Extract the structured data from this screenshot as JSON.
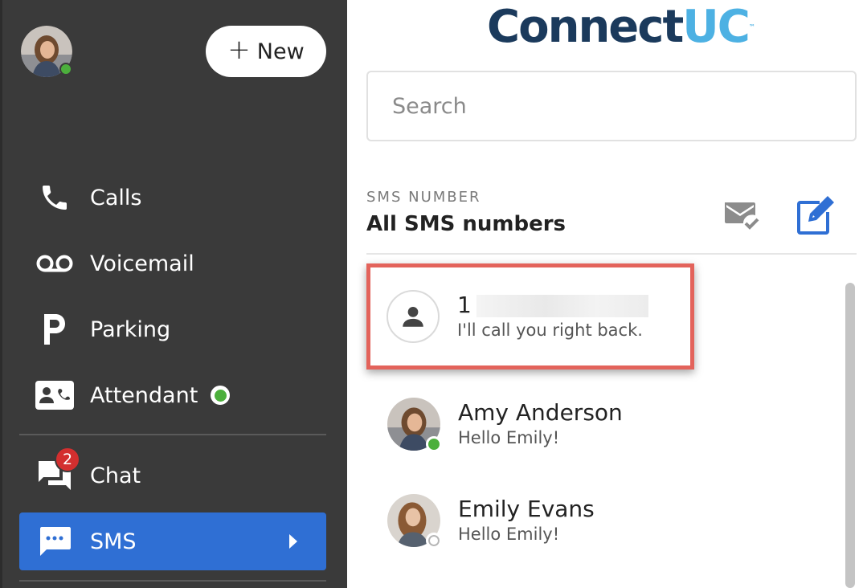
{
  "brand": {
    "name_part1": "Connect",
    "name_part2": "UC",
    "trademark": "™"
  },
  "sidebar": {
    "new_label": "New",
    "items": [
      {
        "label": "Calls",
        "icon": "phone-icon"
      },
      {
        "label": "Voicemail",
        "icon": "voicemail-icon"
      },
      {
        "label": "Parking",
        "icon": "parking-icon"
      },
      {
        "label": "Attendant",
        "icon": "attendant-icon",
        "status": "online"
      },
      {
        "label": "Chat",
        "icon": "chat-icon",
        "badge": "2"
      },
      {
        "label": "SMS",
        "icon": "sms-icon",
        "active": true
      }
    ]
  },
  "search": {
    "placeholder": "Search"
  },
  "sms_number": {
    "caption": "SMS NUMBER",
    "value": "All SMS numbers"
  },
  "conversations": [
    {
      "name": "1",
      "preview": "I'll call you right back.",
      "avatar": "person-icon"
    },
    {
      "name": "Amy Anderson",
      "preview": "Hello Emily!",
      "status": "online"
    },
    {
      "name": "Emily Evans",
      "preview": "Hello Emily!",
      "status": "offline"
    }
  ],
  "colors": {
    "sidebar_bg": "#3a3a3a",
    "active_bg": "#2f6fd4",
    "highlight_border": "#e3635b",
    "online": "#4caf3c",
    "badge": "#d32f2f",
    "brand_dark": "#1b3a5c",
    "brand_light": "#4db1e3"
  }
}
